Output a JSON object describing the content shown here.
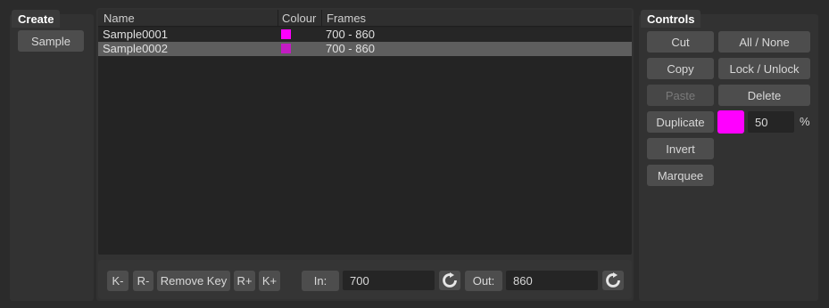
{
  "create": {
    "title": "Create",
    "sample_button": "Sample"
  },
  "list": {
    "columns": [
      "Name",
      "Colour",
      "Frames"
    ],
    "rows": [
      {
        "name": "Sample0001",
        "colour": "#ff00ff",
        "frames": "700 - 860",
        "selected": false
      },
      {
        "name": "Sample0002",
        "colour": "#ff00ff",
        "frames": "700 - 860",
        "selected": true
      }
    ]
  },
  "keys": {
    "k_minus": "K-",
    "r_minus": "R-",
    "remove_key": "Remove Key",
    "r_plus": "R+",
    "k_plus": "K+"
  },
  "range": {
    "in_label": "In:",
    "in_value": "700",
    "out_label": "Out:",
    "out_value": "860",
    "reset_icon": "reset-icon"
  },
  "controls": {
    "title": "Controls",
    "cut": "Cut",
    "all_none": "All / None",
    "copy": "Copy",
    "lock_unlock": "Lock / Unlock",
    "paste": "Paste",
    "delete": "Delete",
    "duplicate": "Duplicate",
    "colour": "#ff00ff",
    "opacity_value": "50",
    "opacity_unit": "%",
    "invert": "Invert",
    "marquee": "Marquee"
  }
}
